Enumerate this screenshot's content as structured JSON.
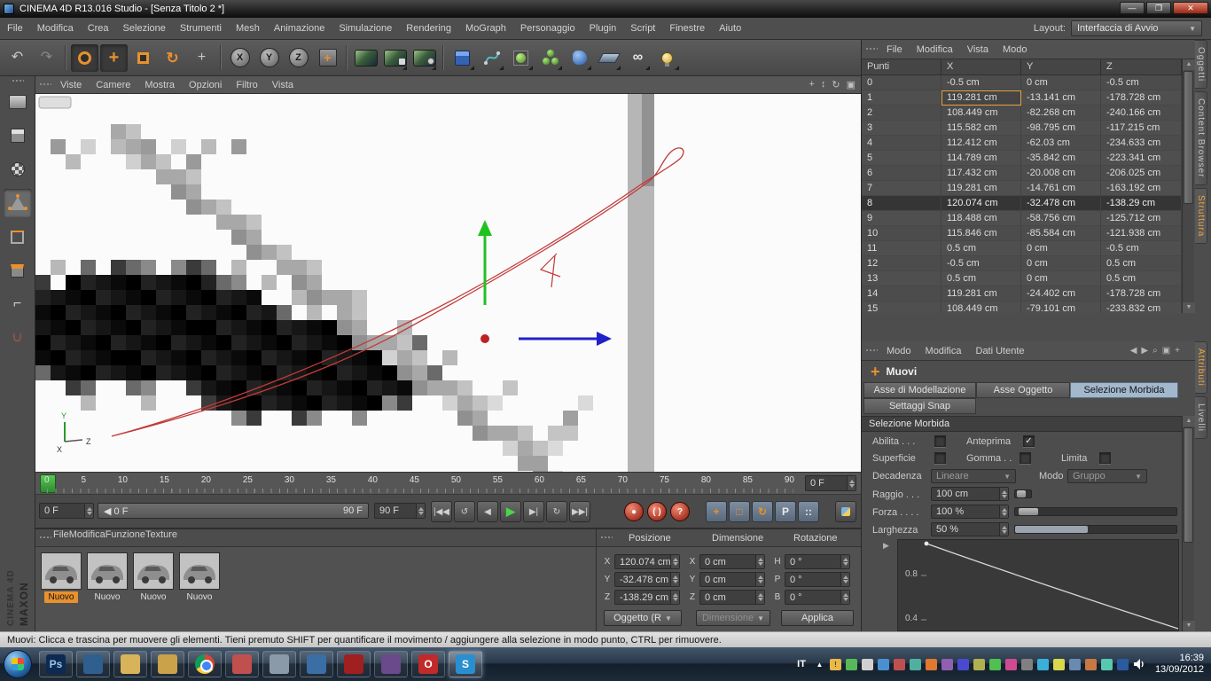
{
  "titlebar": {
    "title": "CINEMA 4D R13.016 Studio - [Senza Titolo 2 *]"
  },
  "menubar": {
    "items": [
      "File",
      "Modifica",
      "Crea",
      "Selezione",
      "Strumenti",
      "Mesh",
      "Animazione",
      "Simulazione",
      "Rendering",
      "MoGraph",
      "Personaggio",
      "Plugin",
      "Script",
      "Finestre",
      "Aiuto"
    ],
    "layout_label": "Layout:",
    "layout_value": "Interfaccia di Avvio"
  },
  "toolbar": {
    "axis_locks": [
      "X",
      "Y",
      "Z"
    ]
  },
  "viewport": {
    "menu": [
      "Viste",
      "Camere",
      "Mostra",
      "Opzioni",
      "Filtro",
      "Vista"
    ],
    "axis_labels": {
      "y": "Y",
      "z": "Z",
      "x": "X"
    }
  },
  "points_panel": {
    "menu": [
      "File",
      "Modifica",
      "Vista",
      "Modo"
    ],
    "columns": [
      "Punti",
      "X",
      "Y",
      "Z"
    ],
    "rows": [
      {
        "i": "0",
        "x": "-0.5 cm",
        "y": "0 cm",
        "z": "-0.5 cm"
      },
      {
        "i": "1",
        "x": "119.281 cm",
        "y": "-13.141 cm",
        "z": "-178.728 cm",
        "xcls": "focus"
      },
      {
        "i": "2",
        "x": "108.449 cm",
        "y": "-82.268 cm",
        "z": "-240.166 cm"
      },
      {
        "i": "3",
        "x": "115.582 cm",
        "y": "-98.795 cm",
        "z": "-117.215 cm"
      },
      {
        "i": "4",
        "x": "112.412 cm",
        "y": "-62.03 cm",
        "z": "-234.633 cm"
      },
      {
        "i": "5",
        "x": "114.789 cm",
        "y": "-35.842 cm",
        "z": "-223.341 cm"
      },
      {
        "i": "6",
        "x": "117.432 cm",
        "y": "-20.008 cm",
        "z": "-206.025 cm"
      },
      {
        "i": "7",
        "x": "119.281 cm",
        "y": "-14.761 cm",
        "z": "-163.192 cm"
      },
      {
        "i": "8",
        "x": "120.074 cm",
        "y": "-32.478 cm",
        "z": "-138.29 cm",
        "rowcls": "sel"
      },
      {
        "i": "9",
        "x": "118.488 cm",
        "y": "-58.756 cm",
        "z": "-125.712 cm"
      },
      {
        "i": "10",
        "x": "115.846 cm",
        "y": "-85.584 cm",
        "z": "-121.938 cm"
      },
      {
        "i": "11",
        "x": "0.5 cm",
        "y": "0 cm",
        "z": "-0.5 cm"
      },
      {
        "i": "12",
        "x": "-0.5 cm",
        "y": "0 cm",
        "z": "0.5 cm"
      },
      {
        "i": "13",
        "x": "0.5 cm",
        "y": "0 cm",
        "z": "0.5 cm"
      },
      {
        "i": "14",
        "x": "119.281 cm",
        "y": "-24.402 cm",
        "z": "-178.728 cm"
      },
      {
        "i": "15",
        "x": "108.449 cm",
        "y": "-79.101 cm",
        "z": "-233.832 cm"
      }
    ]
  },
  "side_tabs": {
    "top": [
      {
        "label": "Oggetti"
      },
      {
        "label": "Content Browser"
      },
      {
        "label": "Struttura",
        "cls": "active"
      }
    ],
    "bottom": [
      {
        "label": "Attributi",
        "cls": "active"
      },
      {
        "label": "Livelli"
      }
    ]
  },
  "attributes": {
    "menu": [
      "Modo",
      "Modifica",
      "Dati Utente"
    ],
    "tool_label": "Muovi",
    "tabs": [
      {
        "label": "Asse di Modellazione"
      },
      {
        "label": "Asse Oggetto"
      },
      {
        "label": "Selezione Morbida",
        "cls": "active"
      },
      {
        "label": "Settaggi Snap"
      }
    ],
    "section_title": "Selezione Morbida",
    "abilita_label": "Abilita . . .",
    "anteprima_label": "Anteprima",
    "anteprima_check": "✓",
    "superficie_label": "Superficie",
    "gomma_label": "Gomma . .",
    "limita_label": "Limita",
    "decadenza_label": "Decadenza",
    "decadenza_value": "Lineare",
    "modo_label": "Modo",
    "modo_value": "Gruppo",
    "raggio_label": "Raggio . . .",
    "raggio_value": "100 cm",
    "forza_label": "Forza . . . .",
    "forza_value": "100 %",
    "larghezza_label": "Larghezza",
    "larghezza_value": "50 %",
    "curve_y_labels": [
      "0.8",
      "0.4"
    ]
  },
  "timeline": {
    "ticks": [
      "0",
      "5",
      "10",
      "15",
      "20",
      "25",
      "30",
      "35",
      "40",
      "45",
      "50",
      "55",
      "60",
      "65",
      "70",
      "75",
      "80",
      "85",
      "90"
    ],
    "frame_box": "0 F",
    "start_box": "0 F",
    "range_start": "◀ 0 F",
    "range_end": "90 F",
    "end_box": "90 F",
    "transport": [
      {
        "name": "goto-start-button",
        "glyph": "|◀◀"
      },
      {
        "name": "play-reverse-button",
        "glyph": "↺"
      },
      {
        "name": "prev-frame-button",
        "glyph": "◀"
      },
      {
        "name": "play-button",
        "glyph": "▶",
        "cls": "play"
      },
      {
        "name": "next-frame-button",
        "glyph": "▶|"
      },
      {
        "name": "loop-button",
        "glyph": "↻"
      },
      {
        "name": "goto-end-button",
        "glyph": "▶▶|"
      }
    ],
    "record": [
      {
        "name": "record-keyframe-button",
        "glyph": "●"
      },
      {
        "name": "autokey-button",
        "glyph": "( )"
      },
      {
        "name": "record-help-button",
        "glyph": "?"
      }
    ],
    "toggles": [
      {
        "name": "record-position-toggle",
        "glyph": "+",
        "gcls": "og"
      },
      {
        "name": "record-scale-toggle",
        "glyph": "□",
        "gcls": "og"
      },
      {
        "name": "record-rotation-toggle",
        "glyph": "↻",
        "gcls": "og"
      },
      {
        "name": "record-parameter-toggle",
        "glyph": "P",
        "gcls": ""
      },
      {
        "name": "record-pla-toggle",
        "glyph": "::",
        "gcls": ""
      }
    ]
  },
  "materials": {
    "menu": [
      "File",
      "Modifica",
      "Funzione",
      "Texture"
    ],
    "items": [
      {
        "label": "Nuovo",
        "cls": "selected"
      },
      {
        "label": "Nuovo"
      },
      {
        "label": "Nuovo"
      },
      {
        "label": "Nuovo"
      }
    ]
  },
  "coords": {
    "pos_header": "Posizione",
    "dim_header": "Dimensione",
    "rot_header": "Rotazione",
    "pos": [
      {
        "l": "X",
        "v": "120.074 cm"
      },
      {
        "l": "Y",
        "v": "-32.478 cm"
      },
      {
        "l": "Z",
        "v": "-138.29 cm"
      }
    ],
    "dim": [
      {
        "l": "X",
        "v": "0 cm"
      },
      {
        "l": "Y",
        "v": "0 cm"
      },
      {
        "l": "Z",
        "v": "0 cm"
      }
    ],
    "rot": [
      {
        "l": "H",
        "v": "0 °"
      },
      {
        "l": "P",
        "v": "0 °"
      },
      {
        "l": "B",
        "v": "0 °"
      }
    ],
    "object_dropdown": "Oggetto (R",
    "dimension_dropdown": "Dimensione",
    "apply_label": "Applica"
  },
  "statusbar": {
    "text": "Muovi: Clicca e trascina per muovere gli elementi. Tieni premuto SHIFT per quantificare il movimento / aggiungere alla selezione in modo punto, CTRL per rimuovere."
  },
  "logo": {
    "line1": "MAXON",
    "line2": "CINEMA 4D"
  },
  "taskbar": {
    "lang": "IT",
    "time": "16:39",
    "date": "13/09/2012",
    "apps": [
      {
        "name": "taskbar-app-photoshop",
        "bg": "#0d2a52",
        "glyph": "Ps",
        "fg": "#9cc3f0"
      },
      {
        "name": "taskbar-app-blue",
        "bg": "#2f5f8f",
        "glyph": ""
      },
      {
        "name": "taskbar-app-folder",
        "bg": "#d8b35a",
        "glyph": ""
      },
      {
        "name": "taskbar-app-explorer",
        "bg": "#caa24a",
        "glyph": ""
      },
      {
        "name": "taskbar-app-chrome",
        "bg": "#ddd",
        "glyph": "",
        "cls": "chrome"
      },
      {
        "name": "taskbar-app-orange",
        "bg": "#c0504e",
        "glyph": ""
      },
      {
        "name": "taskbar-app-window",
        "bg": "#8a9aa8",
        "glyph": ""
      },
      {
        "name": "taskbar-app-media",
        "bg": "#3a6ea5",
        "glyph": ""
      },
      {
        "name": "taskbar-app-reader",
        "bg": "#a02020",
        "glyph": ""
      },
      {
        "name": "taskbar-app-purple",
        "bg": "#6a4a8a",
        "glyph": ""
      },
      {
        "name": "taskbar-app-opera",
        "bg": "#c02a2a",
        "glyph": "O"
      },
      {
        "name": "taskbar-app-skype",
        "bg": "#2a8fd0",
        "glyph": "S",
        "cls": "active"
      }
    ],
    "tray": [
      {
        "bg": "transparent",
        "glyph": "▲"
      },
      {
        "bg": "#e8b84a",
        "glyph": "!",
        "fg": "#5a3a00"
      },
      {
        "bg": "#58b858",
        "glyph": ""
      },
      {
        "bg": "#d0d0d0",
        "glyph": ""
      },
      {
        "bg": "#4a90d0",
        "glyph": ""
      },
      {
        "bg": "#c05050",
        "glyph": ""
      },
      {
        "bg": "#50b0a0",
        "glyph": ""
      },
      {
        "bg": "#e07830",
        "glyph": ""
      },
      {
        "bg": "#9060b0",
        "glyph": ""
      },
      {
        "bg": "#4a4ad0",
        "glyph": ""
      },
      {
        "bg": "#b0b050",
        "glyph": ""
      },
      {
        "bg": "#50c050",
        "glyph": ""
      },
      {
        "bg": "#d04a90",
        "glyph": ""
      },
      {
        "bg": "#808080",
        "glyph": ""
      },
      {
        "bg": "#3ab0d8",
        "glyph": ""
      },
      {
        "bg": "#d8d84a",
        "glyph": ""
      },
      {
        "bg": "#6a8ab0",
        "glyph": ""
      },
      {
        "bg": "#c87840",
        "glyph": ""
      },
      {
        "bg": "#58c8b0",
        "glyph": ""
      },
      {
        "bg": "#2a5aa0",
        "glyph": ""
      }
    ]
  }
}
